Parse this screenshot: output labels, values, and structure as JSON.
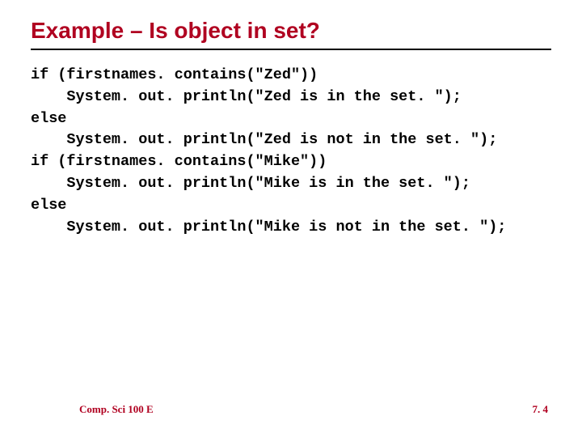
{
  "title": "Example – Is object in set?",
  "code": "if (firstnames. contains(\"Zed\"))\n    System. out. println(\"Zed is in the set. \");\nelse\n    System. out. println(\"Zed is not in the set. \");\nif (firstnames. contains(\"Mike\"))\n    System. out. println(\"Mike is in the set. \");\nelse\n    System. out. println(\"Mike is not in the set. \");",
  "footer": {
    "left": "Comp. Sci 100 E",
    "right": "7. 4"
  }
}
